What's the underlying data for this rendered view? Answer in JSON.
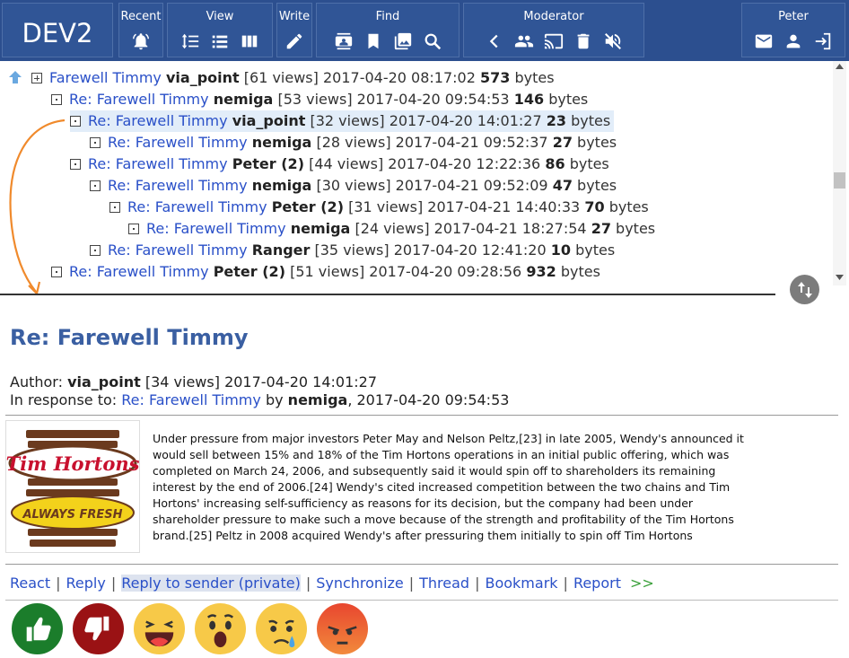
{
  "topbar": {
    "logo": "DEV2",
    "groups": {
      "recent": "Recent",
      "view": "View",
      "write": "Write",
      "find": "Find",
      "moderator": "Moderator",
      "user": "Peter"
    }
  },
  "tree": {
    "rows": [
      {
        "subject": "Farewell Timmy",
        "author": "via_point",
        "views": "[61 views]",
        "date": "2017-04-20 08:17:02",
        "size": "573",
        "unit": "bytes"
      },
      {
        "subject": "Re: Farewell Timmy",
        "author": "nemiga",
        "views": "[53 views]",
        "date": "2017-04-20 09:54:53",
        "size": "146",
        "unit": "bytes"
      },
      {
        "subject": "Re: Farewell Timmy",
        "author": "via_point",
        "views": "[32 views]",
        "date": "2017-04-20 14:01:27",
        "size": "23",
        "unit": "bytes"
      },
      {
        "subject": "Re: Farewell Timmy",
        "author": "nemiga",
        "views": "[28 views]",
        "date": "2017-04-21 09:52:37",
        "size": "27",
        "unit": "bytes"
      },
      {
        "subject": "Re: Farewell Timmy",
        "author": "Peter (2)",
        "views": "[44 views]",
        "date": "2017-04-20 12:22:36",
        "size": "86",
        "unit": "bytes"
      },
      {
        "subject": "Re: Farewell Timmy",
        "author": "nemiga",
        "views": "[30 views]",
        "date": "2017-04-21 09:52:09",
        "size": "47",
        "unit": "bytes"
      },
      {
        "subject": "Re: Farewell Timmy",
        "author": "Peter (2)",
        "views": "[31 views]",
        "date": "2017-04-21 14:40:33",
        "size": "70",
        "unit": "bytes"
      },
      {
        "subject": "Re: Farewell Timmy",
        "author": "nemiga",
        "views": "[24 views]",
        "date": "2017-04-21 18:27:54",
        "size": "27",
        "unit": "bytes"
      },
      {
        "subject": "Re: Farewell Timmy",
        "author": "Ranger",
        "views": "[35 views]",
        "date": "2017-04-20 12:41:20",
        "size": "10",
        "unit": "bytes"
      },
      {
        "subject": "Re: Farewell Timmy",
        "author": "Peter (2)",
        "views": "[51 views]",
        "date": "2017-04-20 09:28:56",
        "size": "932",
        "unit": "bytes"
      }
    ]
  },
  "message": {
    "title": "Re: Farewell Timmy",
    "author_label": "Author:",
    "author": "via_point",
    "views": "[34 views]",
    "date": "2017-04-20 14:01:27",
    "response_label": "In response to:",
    "response_subject": "Re: Farewell Timmy",
    "by_label": "by",
    "response_author": "nemiga",
    "response_date": ", 2017-04-20 09:54:53",
    "image_text_1": "Tim Hortons",
    "image_text_2": "ALWAYS FRESH",
    "body": "Under pressure from major investors Peter May and Nelson Peltz,[23] in late 2005, Wendy's announced it would sell between 15% and 18% of the Tim Hortons operations in an initial public offering, which was completed on March 24, 2006, and subsequently said it would spin off to shareholders its remaining interest by the end of 2006.[24] Wendy's cited increased competition between the two chains and Tim Hortons' increasing self-sufficiency as reasons for its decision, but the company had been under shareholder pressure to make such a move because of the strength and profitability of the Tim Hortons brand.[25] Peltz in 2008 acquired Wendy's after pressuring them initially to spin off Tim Hortons"
  },
  "actions": {
    "react": "React",
    "reply": "Reply",
    "reply_private": "Reply to sender (private)",
    "synchronize": "Synchronize",
    "thread": "Thread",
    "bookmark": "Bookmark",
    "report": "Report",
    "more": ">>",
    "sep": "|"
  },
  "colors": {
    "topbar": "#2c4f8f",
    "link": "#2a50c8",
    "title": "#3a5fa2",
    "arrow": "#f08a2c"
  }
}
